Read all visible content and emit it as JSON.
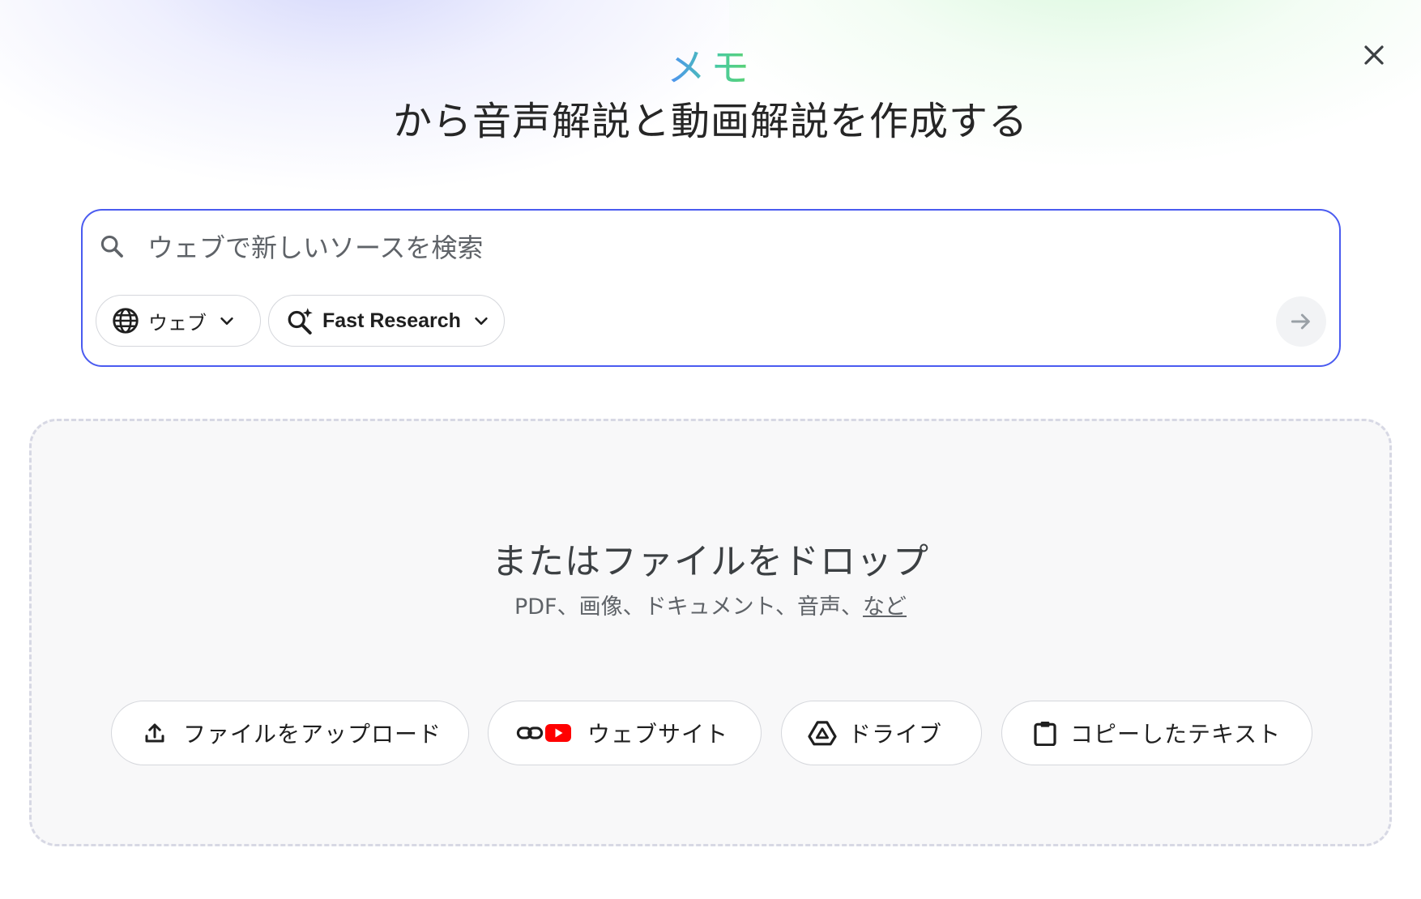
{
  "header": {
    "accent_word": "メモ",
    "title": "から音声解説と動画解説を作成する",
    "close_label": "×"
  },
  "search": {
    "placeholder": "ウェブで新しいソースを検索",
    "source_chip_label": "ウェブ",
    "mode_chip_label": "Fast Research",
    "icons": {
      "search": "search-icon",
      "globe": "globe-icon",
      "research": "sparkle-search-icon",
      "submit": "arrow-right-icon"
    }
  },
  "drop_zone": {
    "title": "またはファイルをドロップ",
    "subtitle": "PDF、画像、ドキュメント、音声、",
    "more_link": "など"
  },
  "source_buttons": [
    {
      "label": "ファイルをアップロード",
      "icon": "upload-icon"
    },
    {
      "label": "ウェブサイト",
      "icon": "link-youtube-icon"
    },
    {
      "label": "ドライブ",
      "icon": "drive-icon"
    },
    {
      "label": "コピーしたテキスト",
      "icon": "clipboard-icon"
    }
  ],
  "colors": {
    "accent_gradient": [
      "#4f8ff7",
      "#5ed46b"
    ],
    "search_border": "#4a5bf0",
    "youtube_red": "#ff0000"
  }
}
